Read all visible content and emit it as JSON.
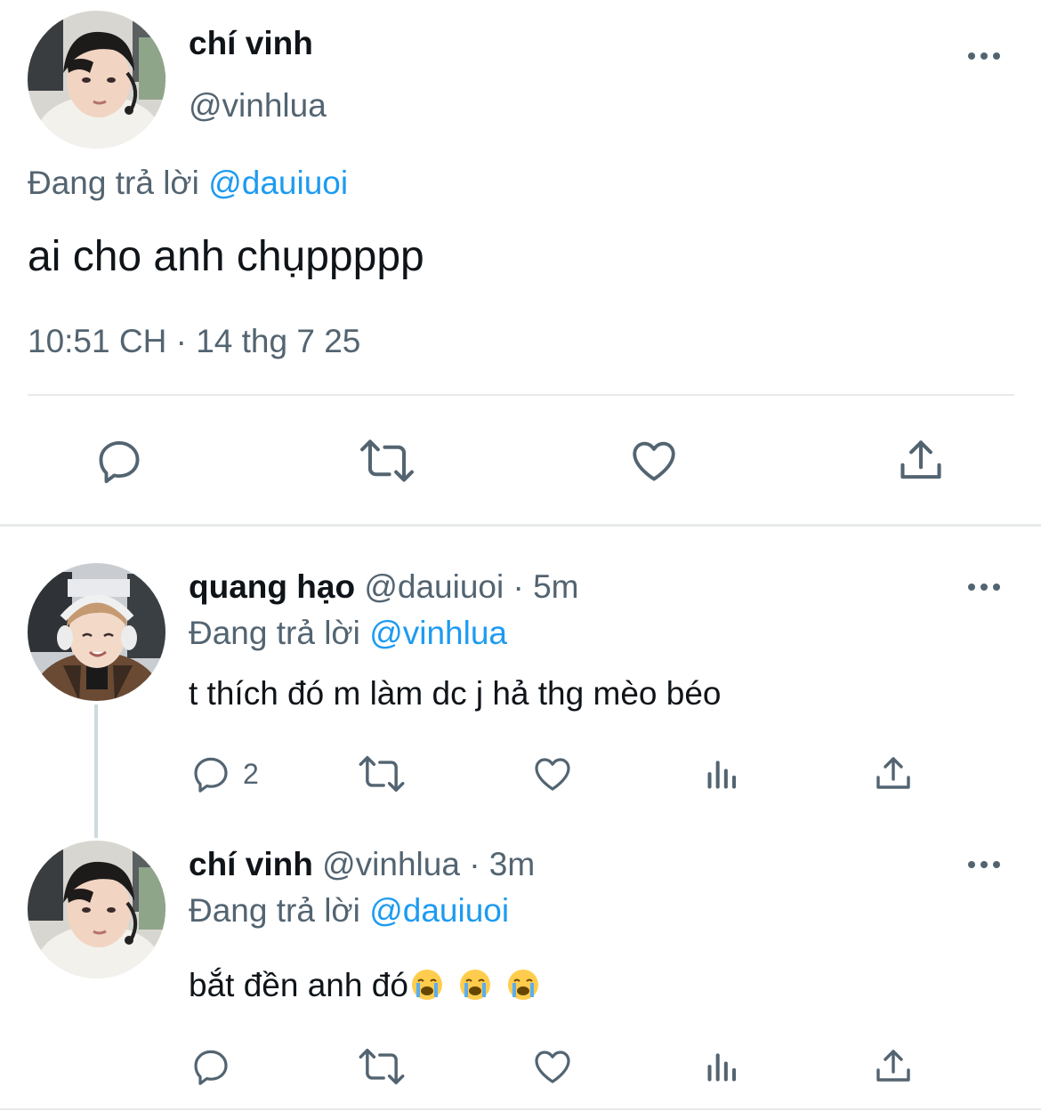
{
  "main_tweet": {
    "display_name": "chí vinh",
    "handle": "@vinhlua",
    "reply_prefix": "Đang trả lời",
    "reply_to": "@dauiuoi",
    "text": "ai cho anh chụppppp",
    "timestamp": "10:51 CH · 14 thg 7 25",
    "actions": [
      "reply-icon",
      "retweet-icon",
      "like-icon",
      "share-icon"
    ]
  },
  "replies": [
    {
      "display_name": "quang hạo",
      "handle": "@dauiuoi",
      "time": "· 5m",
      "reply_prefix": "Đang trả lời",
      "reply_to": "@vinhlua",
      "text": "t thích đó m làm dc j hả thg mèo béo",
      "reply_count": "2",
      "actions": [
        "reply-icon",
        "retweet-icon",
        "like-icon",
        "views-icon",
        "share-icon"
      ]
    },
    {
      "display_name": "chí vinh",
      "handle": "@vinhlua",
      "time": "· 3m",
      "reply_prefix": "Đang trả lời",
      "reply_to": "@dauiuoi",
      "text": "bắt đền anh đó",
      "emojis": [
        "loudly-crying-face",
        "loudly-crying-face",
        "loudly-crying-face"
      ],
      "actions": [
        "reply-icon",
        "retweet-icon",
        "like-icon",
        "views-icon",
        "share-icon"
      ]
    }
  ],
  "colors": {
    "text": "#0f1419",
    "secondary": "#536471",
    "link": "#1d9bf0",
    "divider": "#e7e9eb"
  }
}
